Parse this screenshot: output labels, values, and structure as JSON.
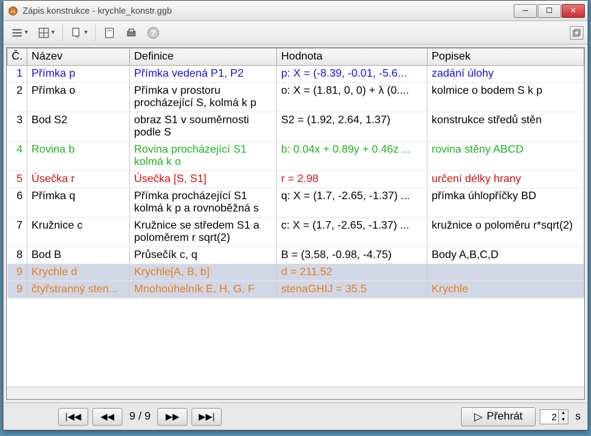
{
  "window": {
    "title": "Zápis konstrukce - krychle_konstr.ggb"
  },
  "columns": {
    "num": "Č.",
    "name": "Název",
    "def": "Definice",
    "val": "Hodnota",
    "cap": "Popisek"
  },
  "rows": [
    {
      "n": "1",
      "name": "Přímka p",
      "def": "Přímka vedená P1, P2",
      "val": "p: X = (-8.39, -0.01, -5.6...",
      "cap": "zadání úlohy",
      "color": "c-blue",
      "sel": false
    },
    {
      "n": "2",
      "name": "Přímka o",
      "def": "Přímka v prostoru procházející S, kolmá k p",
      "val": "o: X = (1.81, 0, 0) + λ (0....",
      "cap": "kolmice o bodem S k p",
      "color": "c-black",
      "sel": false
    },
    {
      "n": "3",
      "name": "Bod S2",
      "def": "obraz S1 v souměrnosti podle S",
      "val": "S2 = (1.92, 2.64, 1.37)",
      "cap": "konstrukce středů stěn",
      "color": "c-black",
      "sel": false
    },
    {
      "n": "4",
      "name": "Rovina b",
      "def": "Rovina procházející S1 kolmá k o",
      "val": "b: 0.04x + 0.89y + 0.46z ...",
      "cap": "rovina stěny ABCD",
      "color": "c-green",
      "sel": false
    },
    {
      "n": "5",
      "name": "Úsečka r",
      "def": "Úsečka [S, S1]",
      "val": "r = 2.98",
      "cap": "určení délky hrany",
      "color": "c-red",
      "sel": false
    },
    {
      "n": "6",
      "name": "Přímka q",
      "def": "Přímka procházející S1 kolmá k p a rovnoběžná s",
      "val": "q: X = (1.7, -2.65, -1.37) ...",
      "cap": "přímka úhlopříčky BD",
      "color": "c-black",
      "sel": false
    },
    {
      "n": "7",
      "name": "Kružnice c",
      "def": "Kružnice se středem S1 a poloměrem r sqrt(2)",
      "val": "c: X = (1.7, -2.65, -1.37) ...",
      "cap": "kružnice o poloměru r*sqrt(2)",
      "color": "c-black",
      "sel": false
    },
    {
      "n": "8",
      "name": "Bod B",
      "def": "Průsečík c, q",
      "val": "B = (3.58, -0.98, -4.75)",
      "cap": "Body A,B,C,D",
      "color": "c-black",
      "sel": false
    },
    {
      "n": "9",
      "name": "Krychle d",
      "def": "Krychle[A, B, b]",
      "val": "d = 211.52",
      "cap": "",
      "color": "c-orange",
      "sel": true
    },
    {
      "n": "9",
      "name": "čtyřstranný sten...",
      "def": "Mnohoúhelník E, H, G, F",
      "val": "stenaGHIJ = 35.5",
      "cap": "Krychle",
      "color": "c-orange",
      "sel": true
    }
  ],
  "footer": {
    "position": "9 / 9",
    "play": "Přehrát",
    "seconds": "2",
    "seconds_unit": "s"
  }
}
